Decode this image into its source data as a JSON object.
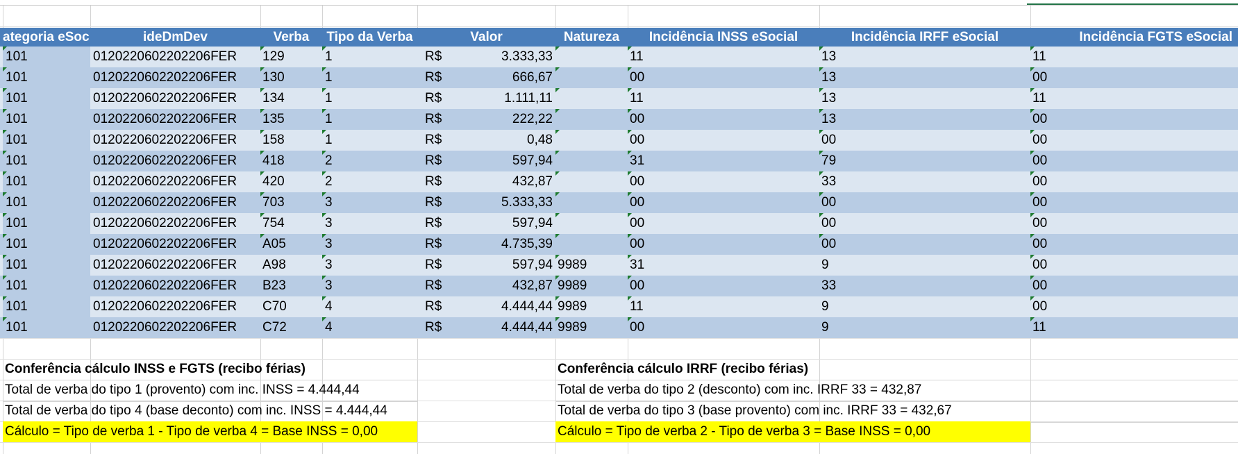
{
  "columns": [
    "ategoria eSoci",
    "ideDmDev",
    "Verba",
    "Tipo da Verba",
    "Valor",
    "Natureza",
    "Incidência INSS eSocial",
    "Incidência IRFF eSocial",
    "Incidência FGTS eSocial"
  ],
  "rows": [
    {
      "cat": "101",
      "ide": "0120220602202206FER",
      "verba": "129",
      "tipo": "1",
      "moeda": "R$",
      "valor": "3.333,33",
      "nat": "",
      "inss": "11",
      "irrf": "13",
      "fgts": "11"
    },
    {
      "cat": "101",
      "ide": "0120220602202206FER",
      "verba": "130",
      "tipo": "1",
      "moeda": "R$",
      "valor": "666,67",
      "nat": "",
      "inss": "00",
      "irrf": "13",
      "fgts": "00"
    },
    {
      "cat": "101",
      "ide": "0120220602202206FER",
      "verba": "134",
      "tipo": "1",
      "moeda": "R$",
      "valor": "1.111,11",
      "nat": "",
      "inss": "11",
      "irrf": "13",
      "fgts": "11"
    },
    {
      "cat": "101",
      "ide": "0120220602202206FER",
      "verba": "135",
      "tipo": "1",
      "moeda": "R$",
      "valor": "222,22",
      "nat": "",
      "inss": "00",
      "irrf": "13",
      "fgts": "00"
    },
    {
      "cat": "101",
      "ide": "0120220602202206FER",
      "verba": "158",
      "tipo": "1",
      "moeda": "R$",
      "valor": "0,48",
      "nat": "",
      "inss": "00",
      "irrf": "00",
      "fgts": "00"
    },
    {
      "cat": "101",
      "ide": "0120220602202206FER",
      "verba": "418",
      "tipo": "2",
      "moeda": "R$",
      "valor": "597,94",
      "nat": "",
      "inss": "31",
      "irrf": "79",
      "fgts": "00"
    },
    {
      "cat": "101",
      "ide": "0120220602202206FER",
      "verba": "420",
      "tipo": "2",
      "moeda": "R$",
      "valor": "432,87",
      "nat": "",
      "inss": "00",
      "irrf": "33",
      "fgts": "00"
    },
    {
      "cat": "101",
      "ide": "0120220602202206FER",
      "verba": "703",
      "tipo": "3",
      "moeda": "R$",
      "valor": "5.333,33",
      "nat": "",
      "inss": "00",
      "irrf": "00",
      "fgts": "00"
    },
    {
      "cat": "101",
      "ide": "0120220602202206FER",
      "verba": "754",
      "tipo": "3",
      "moeda": "R$",
      "valor": "597,94",
      "nat": "",
      "inss": "00",
      "irrf": "00",
      "fgts": "00"
    },
    {
      "cat": "101",
      "ide": "0120220602202206FER",
      "verba": "A05",
      "tipo": "3",
      "moeda": "R$",
      "valor": "4.735,39",
      "nat": "",
      "inss": "00",
      "irrf": "00",
      "fgts": "00"
    },
    {
      "cat": "101",
      "ide": "0120220602202206FER",
      "verba": "A98",
      "tipo": "3",
      "moeda": "R$",
      "valor": "597,94",
      "nat": "9989",
      "inss": "31",
      "irrf": "9",
      "fgts": "00"
    },
    {
      "cat": "101",
      "ide": "0120220602202206FER",
      "verba": "B23",
      "tipo": "3",
      "moeda": "R$",
      "valor": "432,87",
      "nat": "9989",
      "inss": "00",
      "irrf": "33",
      "fgts": "00"
    },
    {
      "cat": "101",
      "ide": "0120220602202206FER",
      "verba": "C70",
      "tipo": "4",
      "moeda": "R$",
      "valor": "4.444,44",
      "nat": "9989",
      "inss": "11",
      "irrf": "9",
      "fgts": "00"
    },
    {
      "cat": "101",
      "ide": "0120220602202206FER",
      "verba": "C72",
      "tipo": "4",
      "moeda": "R$",
      "valor": "4.444,44",
      "nat": "9989",
      "inss": "00",
      "irrf": "9",
      "fgts": "11"
    }
  ],
  "summary_inss": {
    "title": "Conferência cálculo INSS e FGTS (recibo férias)",
    "line1": "Total de verba do tipo 1 (provento) com inc. INSS = 4.444,44",
    "line2": "Total de verba do tipo 4 (base deconto) com inc. INSS = 4.444,44",
    "line3": "Cálculo = Tipo de verba 1 - Tipo de verba 4 = Base INSS = 0,00"
  },
  "summary_irrf": {
    "title": "Conferência cálculo IRRF (recibo férias)",
    "line1": "Total de verba do tipo 2 (desconto) com inc. IRRF 33 = 432,87",
    "line2": "Total de verba do tipo 3 (base provento) com inc. IRRF 33 = 432,67",
    "line3": "Cálculo = Tipo de verba 2 - Tipo de verba 3 = Base INSS = 0,00"
  },
  "colors": {
    "header": "#4a7ebb",
    "band_light": "#dce6f1",
    "band_dark": "#b8cce4",
    "highlight": "#ffff00",
    "error_marker": "#1e7b30"
  }
}
